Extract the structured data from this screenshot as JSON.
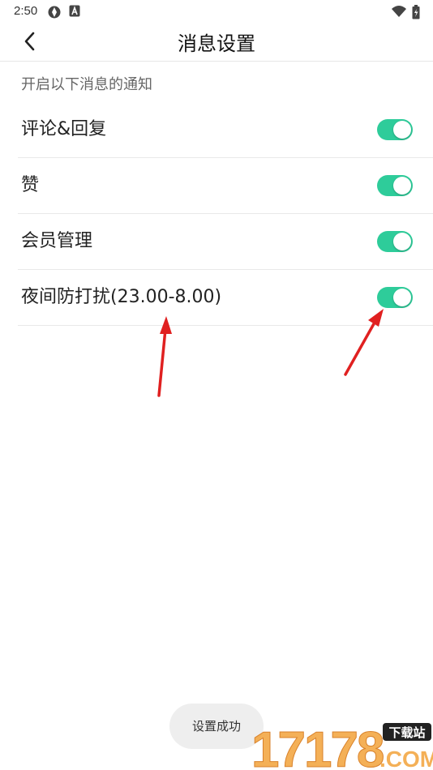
{
  "status_bar": {
    "time": "2:50"
  },
  "header": {
    "title": "消息设置"
  },
  "section_label": "开启以下消息的通知",
  "settings": [
    {
      "label": "评论&回复",
      "on": true
    },
    {
      "label": "赞",
      "on": true
    },
    {
      "label": "会员管理",
      "on": true
    },
    {
      "label": "夜间防打扰(23.00-8.00)",
      "on": true
    }
  ],
  "toast": "设置成功",
  "watermark": {
    "number": "17178",
    "badge": "下载站",
    "domain": ".COM"
  },
  "colors": {
    "toggle_on": "#2ecc9a",
    "annotation_arrow": "#e02020",
    "watermark": "#f2a23a"
  },
  "icons": {
    "back": "chevron-left-icon",
    "status": [
      "app-notification-icon",
      "a-badge-icon",
      "wifi-icon",
      "battery-icon"
    ]
  }
}
